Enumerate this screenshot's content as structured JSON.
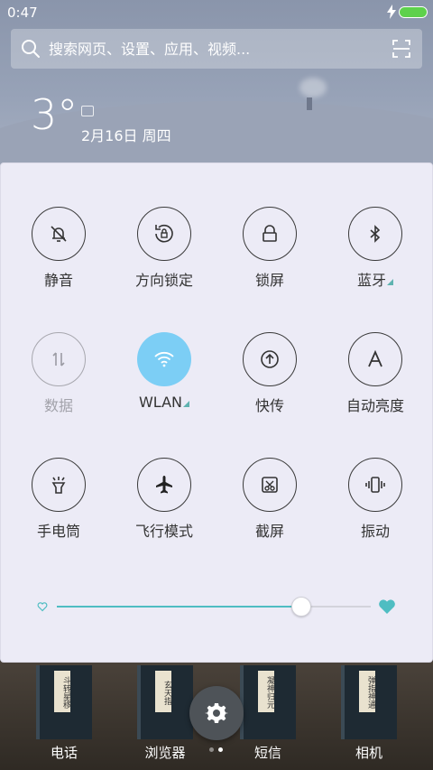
{
  "status_bar": {
    "time": "0:47"
  },
  "search": {
    "placeholder": "搜索网页、设置、应用、视频..."
  },
  "weather": {
    "temperature": "3°",
    "date": "2月16日 周四"
  },
  "toggles": [
    {
      "label": "静音",
      "icon": "bell-off-icon",
      "state": "off"
    },
    {
      "label": "方向锁定",
      "icon": "rotation-lock-icon",
      "state": "off"
    },
    {
      "label": "锁屏",
      "icon": "lock-icon",
      "state": "off"
    },
    {
      "label": "蓝牙",
      "icon": "bluetooth-icon",
      "state": "off"
    },
    {
      "label": "数据",
      "icon": "data-arrows-icon",
      "state": "disabled"
    },
    {
      "label": "WLAN",
      "icon": "wifi-icon",
      "state": "on"
    },
    {
      "label": "快传",
      "icon": "share-upload-icon",
      "state": "off"
    },
    {
      "label": "自动亮度",
      "icon": "auto-brightness-icon",
      "state": "off"
    },
    {
      "label": "手电筒",
      "icon": "flashlight-icon",
      "state": "off"
    },
    {
      "label": "飞行模式",
      "icon": "airplane-icon",
      "state": "off"
    },
    {
      "label": "截屏",
      "icon": "screenshot-icon",
      "state": "off"
    },
    {
      "label": "振动",
      "icon": "vibrate-icon",
      "state": "off"
    }
  ],
  "brightness": {
    "level": 0.78
  },
  "dock": [
    {
      "label": "电话",
      "tag": "斗转星移"
    },
    {
      "label": "浏览器",
      "tag": "玄天指"
    },
    {
      "label": "短信",
      "tag": "凝神归元"
    },
    {
      "label": "相机",
      "tag": "弹指神通"
    }
  ],
  "colors": {
    "accent": "#4fbdc2",
    "wlan_active": "#7ccef5",
    "battery": "#5ed14c",
    "panel_bg": "#ecebf6"
  }
}
